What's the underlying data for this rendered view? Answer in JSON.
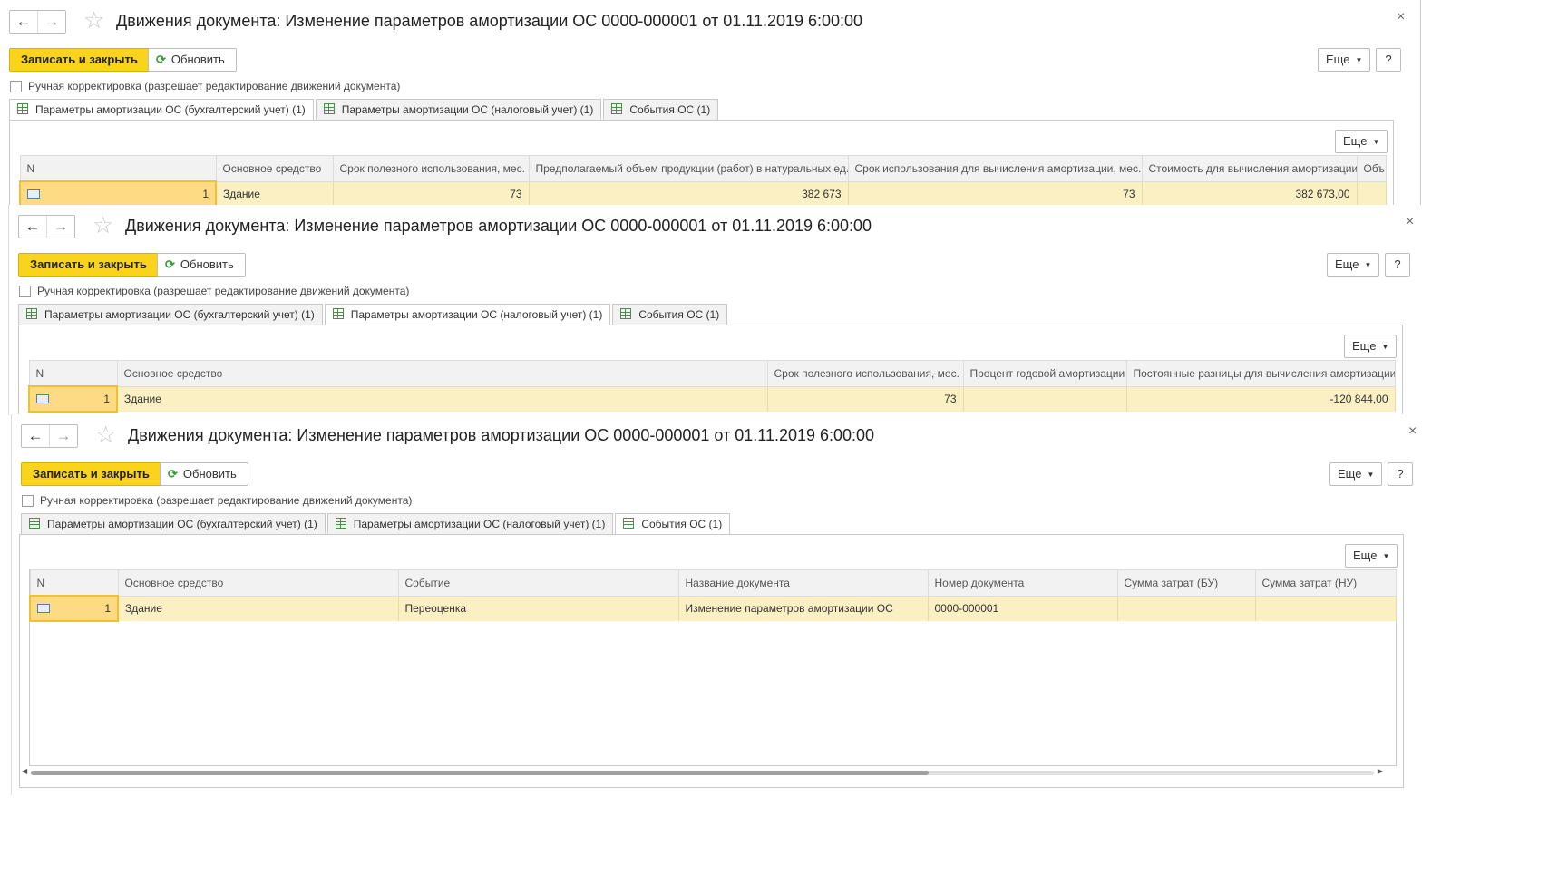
{
  "window": {
    "title": "Движения документа: Изменение параметров амортизации ОС 0000-000001 от 01.11.2019 6:00:00",
    "close": "×"
  },
  "toolbar": {
    "save_close": "Записать и закрыть",
    "refresh": "Обновить",
    "more": "Еще",
    "help": "?"
  },
  "manual_correction": "Ручная корректировка (разрешает редактирование движений документа)",
  "tabs": [
    "Параметры амортизации ОС (бухгалтерский учет) (1)",
    "Параметры амортизации ОС (налоговый учет) (1)",
    "События ОС (1)"
  ],
  "table_more": "Еще",
  "accounting": {
    "columns": [
      "N",
      "Основное средство",
      "Срок полезного использования, мес.",
      "Предполагаемый объем продукции (работ) в натуральных ед.",
      "Срок использования для вычисления амортизации, мес.",
      "Стоимость для вычисления амортизации",
      "Объ"
    ],
    "row": [
      "1",
      "Здание",
      "73",
      "382 673",
      "73",
      "382 673,00",
      ""
    ]
  },
  "tax": {
    "columns": [
      "N",
      "Основное средство",
      "Срок полезного использования, мес.",
      "Процент годовой амортизации",
      "Постоянные разницы для вычисления амортизации"
    ],
    "row": [
      "1",
      "Здание",
      "73",
      "",
      "-120 844,00"
    ]
  },
  "events": {
    "columns": [
      "N",
      "Основное средство",
      "Событие",
      "Название документа",
      "Номер документа",
      "Сумма затрат (БУ)",
      "Сумма затрат (НУ)"
    ],
    "row": [
      "1",
      "Здание",
      "Переоценка",
      "Изменение параметров амортизации ОС",
      "0000-000001",
      "",
      ""
    ]
  }
}
